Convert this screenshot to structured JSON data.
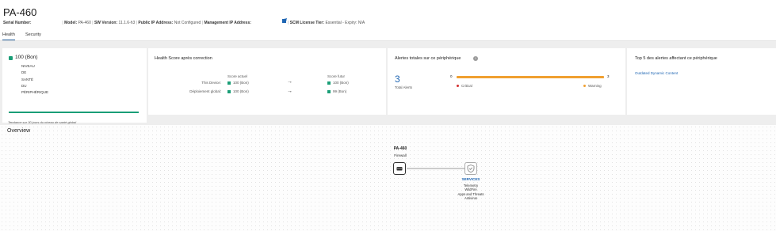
{
  "header": {
    "title": "PA-460",
    "serial_label": "Serial Number:",
    "model_label": "Model:",
    "model_value": "PA-460",
    "sw_label": "SW Version:",
    "sw_value": "11.1.6-h3",
    "public_ip_label": "Public IP Address:",
    "public_ip_value": "Not Configured",
    "mgmt_ip_label": "Management IP Address:",
    "scm_label": "SCM License Tier:",
    "scm_value": "Essential - Expiry: N/A"
  },
  "tabs": [
    {
      "label": "Health",
      "active": true
    },
    {
      "label": "Security",
      "active": false
    }
  ],
  "health_card": {
    "score": "100 (Bon)",
    "lines": [
      "NIVEAU",
      "DE",
      "SANTÉ",
      "DU",
      "PÉRIPHÉRIQUE"
    ],
    "trend_caption": "Tendance sur 30 jours du niveau de santé global",
    "trend_level": 1.0
  },
  "health_after": {
    "title": "Health Score après correction",
    "current_header": "Score actuel",
    "future_header": "Score futur",
    "rows": [
      {
        "label": "This Device:",
        "current": "100 (Bon)",
        "future": "100 (Bon)"
      },
      {
        "label": "Déploiement global:",
        "current": "100 (Bon)",
        "future": "99 (Bon)"
      }
    ]
  },
  "alerts": {
    "title": "Alertes totales sur ce périphérique",
    "total": "3",
    "total_label": "Total Alerts",
    "scale_min": "0",
    "scale_max": "3",
    "critical_label": "Critical",
    "warning_label": "Warning",
    "warning_fraction": 1.0
  },
  "top5": {
    "title": "Top 5 des alertes affectant ce périphérique",
    "items": [
      "Outdated Dynamic Content"
    ]
  },
  "overview": {
    "title": "Overview",
    "device_name": "PA-460",
    "device_type": "Firewall",
    "services_title": "SERVICES",
    "services": [
      "Telemetry",
      "WildFire",
      "Apps and Threats",
      "Antivirus"
    ]
  },
  "colors": {
    "accent": "#1f5c99",
    "green": "#1a9e77",
    "warning": "#f0a030",
    "critical": "#d32f2f",
    "link": "#1f66b3"
  }
}
